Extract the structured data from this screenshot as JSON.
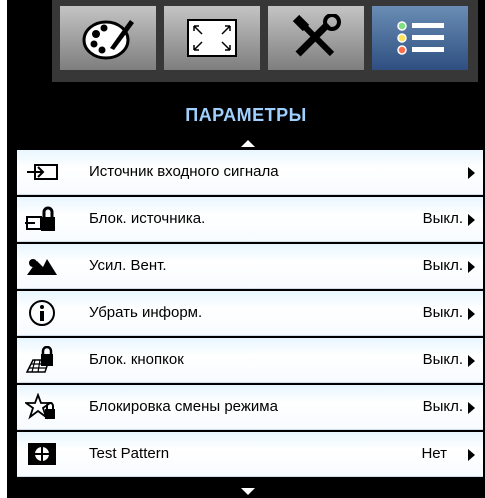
{
  "tabs": [
    {
      "name": "image-settings-tab",
      "icon": "palette-icon"
    },
    {
      "name": "display-settings-tab",
      "icon": "screen-icon"
    },
    {
      "name": "setup-tab",
      "icon": "tools-icon"
    },
    {
      "name": "options-tab",
      "icon": "list-icon",
      "active": true
    }
  ],
  "menu": {
    "title": "ПАРАМЕТРЫ",
    "items": [
      {
        "label": "Источник входного сигнала",
        "value": "",
        "icon": "input-source-icon"
      },
      {
        "label": "Блок. источника.",
        "value": "Выкл.",
        "icon": "source-lock-icon"
      },
      {
        "label": "Усил. Вент.",
        "value": "Выкл.",
        "icon": "high-altitude-icon"
      },
      {
        "label": "Убрать информ.",
        "value": "Выкл.",
        "icon": "info-icon"
      },
      {
        "label": "Блок. кнопкок",
        "value": "Выкл.",
        "icon": "keypad-lock-icon"
      },
      {
        "label": "Блокировка смены режима",
        "value": "Выкл.",
        "icon": "display-mode-lock-icon"
      },
      {
        "label": "Test Pattern",
        "value": "Нет",
        "icon": "test-pattern-icon"
      }
    ]
  },
  "colors": {
    "title": "#9fd0ff",
    "active_tab": "#2e4f80",
    "background": "#000000"
  }
}
